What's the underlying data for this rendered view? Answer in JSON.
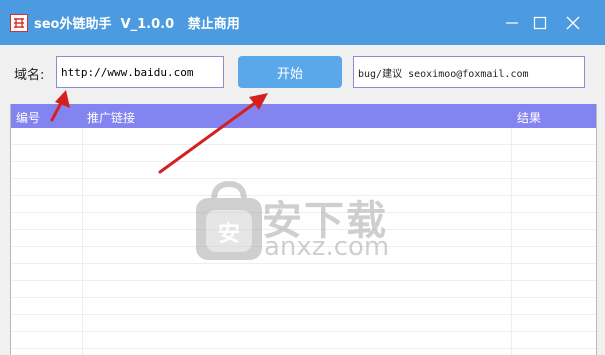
{
  "window": {
    "title": "seo外链助手  V_1.0.0   禁止商用",
    "icon": "app-logo-icon",
    "controls": [
      "minimize-icon",
      "maximize-icon",
      "close-icon"
    ]
  },
  "toolbar": {
    "domain_label": "域名:",
    "domain_value": "http://www.baidu.com",
    "start_label": "开始",
    "contact_text": "bug/建议 seoximoo@foxmail.com"
  },
  "grid": {
    "columns": [
      "编号",
      "推广链接",
      "结果"
    ],
    "rows": []
  },
  "watermark": {
    "brand_cn": "安下载",
    "brand_en": "anxz.com",
    "badge_char": "安"
  },
  "colors": {
    "titlebar": "#4c9be0",
    "header": "#8484f0",
    "button": "#5aa8ea",
    "arrow": "#d42020"
  }
}
